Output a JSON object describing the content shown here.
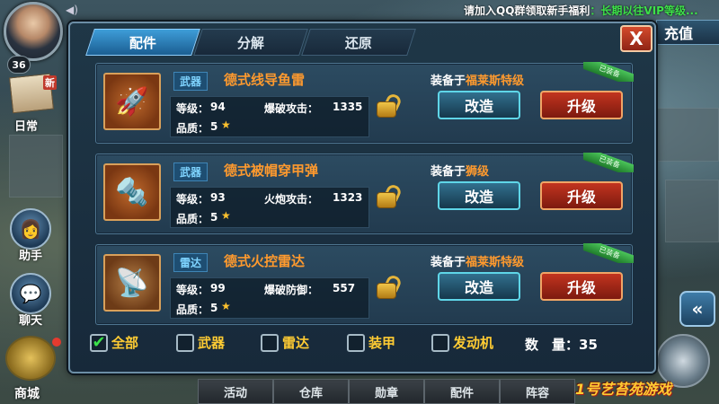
{
  "hud": {
    "player_level": "36",
    "marquee_prefix": "请加入QQ群领取新手福利",
    "marquee_highlight": "：长期以往VIP等级...",
    "recharge_label": "充值"
  },
  "side_menu": {
    "new_tag": "新",
    "daily": "日常",
    "assistant": "助手",
    "chat": "聊天",
    "shop": "商城"
  },
  "dialog": {
    "tabs": [
      "配件",
      "分解",
      "还原"
    ],
    "active_tab": 0,
    "close_label": "X",
    "items": [
      {
        "type": "武器",
        "name": "德式线导鱼雷",
        "level_label": "等级：",
        "level": "94",
        "stat_label": "爆破攻击：",
        "stat_value": "1335",
        "quality_label": "品质：",
        "quality": "5",
        "equipped_prefix": "装备于",
        "equipped_ship": "福莱斯特级",
        "ribbon": "已装备",
        "modify_label": "改造",
        "upgrade_label": "升级",
        "icon": "torpedo-icon"
      },
      {
        "type": "武器",
        "name": "德式被帽穿甲弹",
        "level_label": "等级：",
        "level": "93",
        "stat_label": "火炮攻击：",
        "stat_value": "1323",
        "quality_label": "品质：",
        "quality": "5",
        "equipped_prefix": "装备于",
        "equipped_ship": "狮级",
        "ribbon": "已装备",
        "modify_label": "改造",
        "upgrade_label": "升级",
        "icon": "shell-icon"
      },
      {
        "type": "雷达",
        "name": "德式火控雷达",
        "level_label": "等级：",
        "level": "99",
        "stat_label": "爆破防御：",
        "stat_value": "557",
        "quality_label": "品质：",
        "quality": "5",
        "equipped_prefix": "装备于",
        "equipped_ship": "福莱斯特级",
        "ribbon": "已装备",
        "modify_label": "改造",
        "upgrade_label": "升级",
        "icon": "radar-icon"
      }
    ],
    "filters": [
      {
        "label": "全部",
        "checked": true
      },
      {
        "label": "武器",
        "checked": false
      },
      {
        "label": "雷达",
        "checked": false
      },
      {
        "label": "装甲",
        "checked": false
      },
      {
        "label": "发动机",
        "checked": false
      }
    ],
    "count_label": "数　量：",
    "count_value": "35"
  },
  "bottom_nav": [
    "活动",
    "仓库",
    "勋章",
    "配件",
    "阵容"
  ],
  "watermark": "1号艺苔苑游戏"
}
